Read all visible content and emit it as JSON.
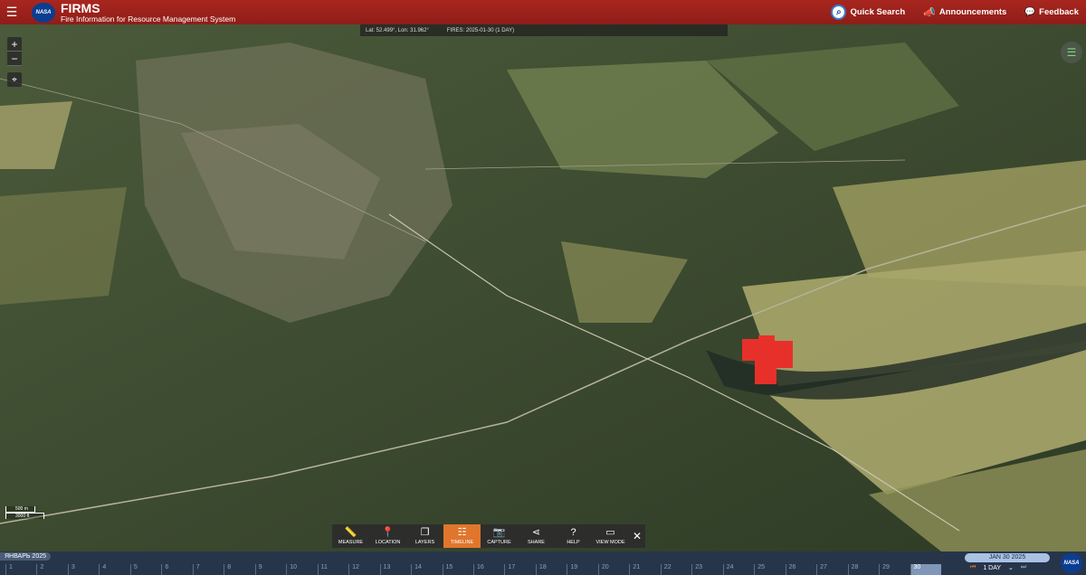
{
  "header": {
    "title": "FIRMS",
    "subtitle": "Fire Information for Resource Management System",
    "logo": "NASA",
    "quick_search": "Quick Search",
    "announcements": "Announcements",
    "feedback": "Feedback"
  },
  "map": {
    "coords": "Lat: 52.499°, Lon: 31.962°",
    "fires": "FIRES: 2025-01-30 (1 DAY)",
    "zoom_in": "+",
    "zoom_out": "−",
    "scale_m": "500 m",
    "scale_ft": "3000 ft",
    "fire_color": "#e8302a"
  },
  "toolbar": {
    "measure": "MEASURE",
    "location": "LOCATION",
    "layers": "LAYERS",
    "timeline": "TIMELINE",
    "capture": "CAPTURE",
    "share": "SHARE",
    "help": "HELP",
    "view_mode": "VIEW MODE"
  },
  "timeline": {
    "month": "ЯНВАРЬ 2025",
    "days": [
      "1",
      "2",
      "3",
      "4",
      "5",
      "6",
      "7",
      "8",
      "9",
      "10",
      "11",
      "12",
      "13",
      "14",
      "15",
      "16",
      "17",
      "18",
      "19",
      "20",
      "21",
      "22",
      "23",
      "24",
      "25",
      "26",
      "27",
      "28",
      "29",
      "30"
    ],
    "selected_day": "30",
    "date": "JAN 30 2025",
    "range": "1 DAY",
    "logo": "NASA"
  },
  "icons": {
    "menu": "hamburger-icon",
    "search": "search-icon",
    "announcement": "megaphone-icon",
    "feedback": "chat-icon",
    "layers_toggle": "layers-list-icon"
  }
}
